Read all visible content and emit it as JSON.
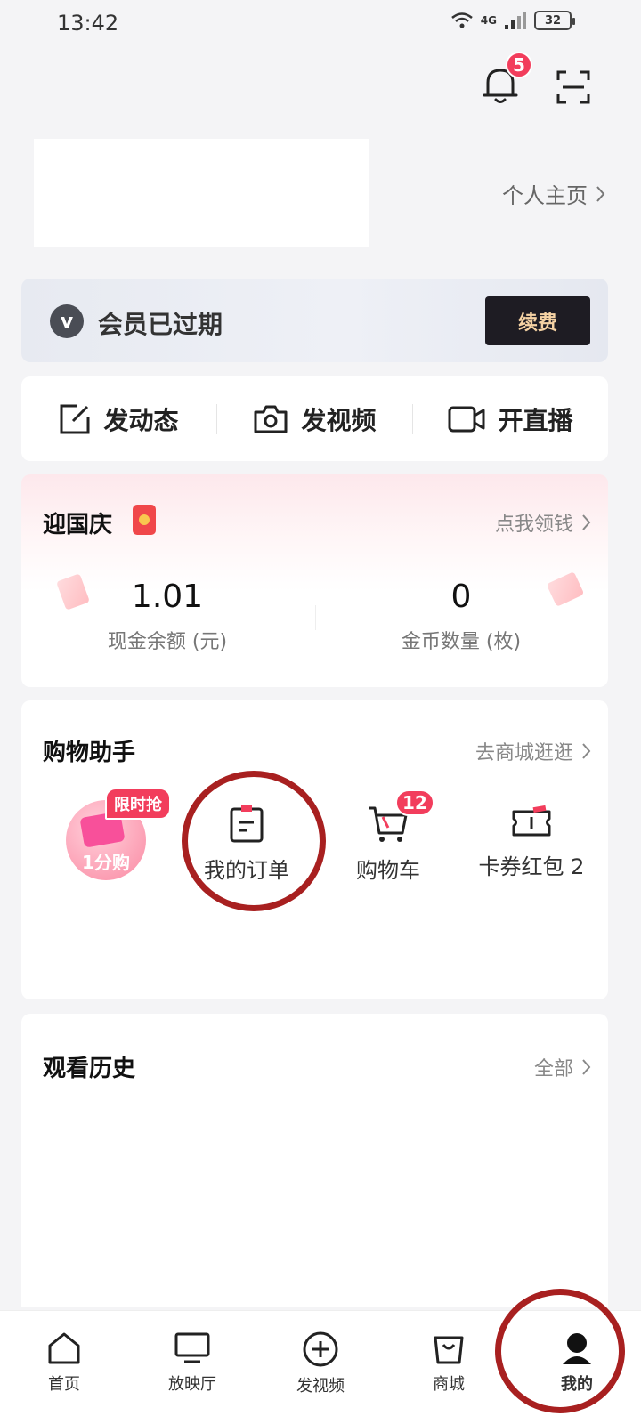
{
  "status_bar": {
    "time": "13:42",
    "network": "4G",
    "battery": "32"
  },
  "header": {
    "notification_count": "5"
  },
  "profile": {
    "homepage_link": "个人主页"
  },
  "vip": {
    "logo_letter": "v",
    "status": "会员已过期",
    "renew_label": "续费"
  },
  "post_actions": [
    {
      "label": "发动态",
      "icon": "edit-icon"
    },
    {
      "label": "发视频",
      "icon": "camera-icon"
    },
    {
      "label": "开直播",
      "icon": "video-camera-icon"
    }
  ],
  "event": {
    "title": "迎国庆",
    "claim_link": "点我领钱",
    "cash": {
      "value": "1.01",
      "label": "现金余额 (元)"
    },
    "coins": {
      "value": "0",
      "label": "金币数量 (枚)"
    }
  },
  "shopping": {
    "title": "购物助手",
    "mall_link": "去商城逛逛",
    "flash_tag": "限时抢",
    "flash_label": "1分购",
    "orders_label": "我的订单",
    "cart_label": "购物车",
    "cart_count": "12",
    "coupons_label": "卡券红包 2"
  },
  "history": {
    "title": "观看历史",
    "all_link": "全部"
  },
  "tabbar": [
    {
      "label": "首页",
      "icon": "home-icon"
    },
    {
      "label": "放映厅",
      "icon": "tv-icon"
    },
    {
      "label": "发视频",
      "icon": "plus-circle-icon"
    },
    {
      "label": "商城",
      "icon": "shopping-bag-icon"
    },
    {
      "label": "我的",
      "icon": "user-icon"
    }
  ],
  "colors": {
    "accent_red": "#f23d5c",
    "annotation_circle": "#a82020",
    "renew_text": "#f6d3a4"
  }
}
